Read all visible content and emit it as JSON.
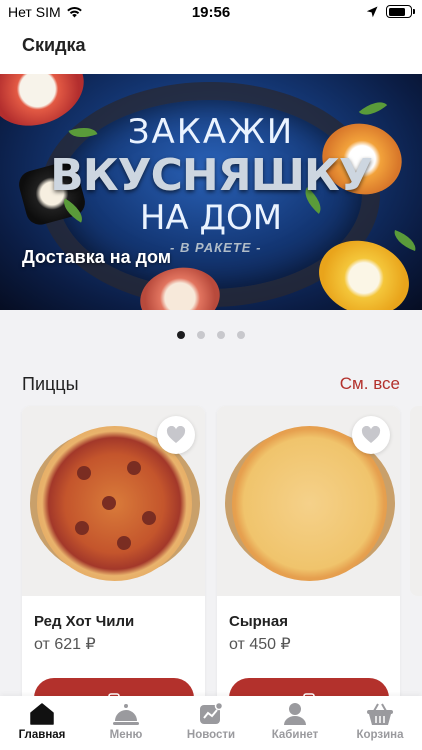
{
  "status_bar": {
    "carrier": "Нет SIM",
    "time": "19:56",
    "battery_level": 0.8
  },
  "header": {
    "title": "Скидка"
  },
  "banner": {
    "headline_1": "ЗАКАЖИ",
    "headline_2": "ВКУСНЯШКУ",
    "headline_3": "НА ДОМ",
    "headline_4": "- В РАКЕТЕ -",
    "caption": "Доставка на дом",
    "slides_total": 4,
    "active_slide": 1
  },
  "section": {
    "title": "Пиццы",
    "see_all": "См. все"
  },
  "products": [
    {
      "name": "Ред Хот Чили",
      "price": "от 621 ₽"
    },
    {
      "name": "Сырная",
      "price": "от 450 ₽"
    }
  ],
  "tabbar": {
    "items": [
      {
        "label": "Главная",
        "icon": "home-icon",
        "active": true
      },
      {
        "label": "Меню",
        "icon": "cloche-icon",
        "active": false
      },
      {
        "label": "Новости",
        "icon": "news-chart-icon",
        "active": false
      },
      {
        "label": "Кабинет",
        "icon": "user-icon",
        "active": false
      },
      {
        "label": "Корзина",
        "icon": "basket-icon",
        "active": false
      }
    ]
  },
  "colors": {
    "accent": "#b3312c",
    "active_tab": "#111111",
    "inactive_tab": "#9a9a9e"
  }
}
